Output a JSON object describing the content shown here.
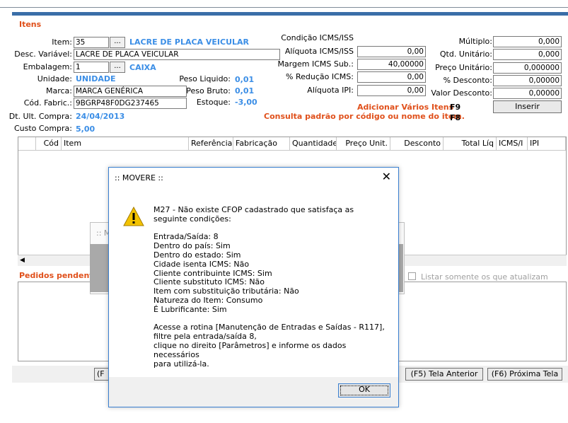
{
  "section": {
    "title": "Itens"
  },
  "item": {
    "item_label": "Item:",
    "item_value": "35",
    "browse_label": "...",
    "item_name": "LACRE DE PLACA VEICULAR",
    "desc_label": "Desc. Variável:",
    "desc_value": "LACRE DE PLACA VEICULAR",
    "emb_label": "Embalagem:",
    "emb_value": "1",
    "emb_name": "CAIXA",
    "unidade_label": "Unidade:",
    "unidade_value": "UNIDADE",
    "marca_label": "Marca:",
    "marca_value": "MARCA GENÉRICA",
    "cod_label": "Cód. Fabric.:",
    "cod_value": "9BGRP48F0DG237465",
    "dt_label": "Dt. Ult. Compra:",
    "dt_value": "24/04/2013",
    "custo_label": "Custo Compra:",
    "custo_value": "5,00",
    "peso_liq_label": "Peso Liquido:",
    "peso_liq_value": "0,01",
    "peso_bruto_label": "Peso Bruto:",
    "peso_bruto_value": "0,01",
    "estoque_label": "Estoque:",
    "estoque_value": "-3,00"
  },
  "icms": {
    "cond_label": "Condição ICMS/ISS",
    "aliq_label": "Alíquota ICMS/ISS",
    "aliq_value": "0,00",
    "margem_label": "Margem ICMS Sub.:",
    "margem_value": "40,00000",
    "reducao_label": "% Redução ICMS:",
    "reducao_value": "0,00",
    "ipi_label": "Alíquota IPI:",
    "ipi_value": "0,00"
  },
  "pricing": {
    "multiplo_label": "Múltiplo:",
    "multiplo_value": "0,000",
    "qtd_label": "Qtd. Unitário:",
    "qtd_value": "0,000",
    "preco_label": "Preço Unitário:",
    "preco_value": "0,000000",
    "desc_pct_label": "% Desconto:",
    "desc_pct_value": "0,00000",
    "valor_desc_label": "Valor Desconto:",
    "valor_desc_value": "0,00000",
    "inserir_label": "Inserir"
  },
  "shortcuts": {
    "adicionar_label": "Adicionar Vários Itens",
    "adicionar_key": "F9",
    "consulta_label": "Consulta padrão por código ou nome do item.",
    "consulta_key": "F8"
  },
  "grid": {
    "columns": [
      "Cód",
      "Item",
      "Referência",
      "Fabricação",
      "Quantidade",
      "Preço Unit.",
      "Desconto",
      "Total Líq",
      "ICMS/I",
      "IPI"
    ]
  },
  "pending": {
    "title": "Pedidos pendente",
    "checkbox_label": "Listar somente os que atualizam custos?"
  },
  "footer": {
    "left_button": "(F",
    "prev_button": "(F5) Tela Anterior",
    "next_button": "(F6) Próxima Tela"
  },
  "ghost": {
    "title": ":: M"
  },
  "dialog": {
    "title": ":: MOVERE ::",
    "close": "✕",
    "message": "M27 - Não existe CFOP cadastrado que satisfaça as seguinte condições:\n\nEntrada/Saída: 8\nDentro do país: Sim\nDentro do estado: Sim\nCidade isenta ICMS: Não\nCliente contribuinte ICMS: Sim\nCliente substituto ICMS: Não\nItem com substituição tributária: Não\nNatureza do Item: Consumo\nÉ Lubrificante: Sim\n\nAcesse a rotina [Manutenção de Entradas e Saídas - R117],\nfiltre pela entrada/saída 8,\nclique no direito [Parâmetros] e informe os dados necessários\npara utilizá-la.",
    "ok": "OK",
    "icon": "warning-icon"
  },
  "colors": {
    "accent_orange": "#e0501b",
    "accent_blue": "#3b8ee6",
    "bar_blue": "#3a6ea8"
  }
}
